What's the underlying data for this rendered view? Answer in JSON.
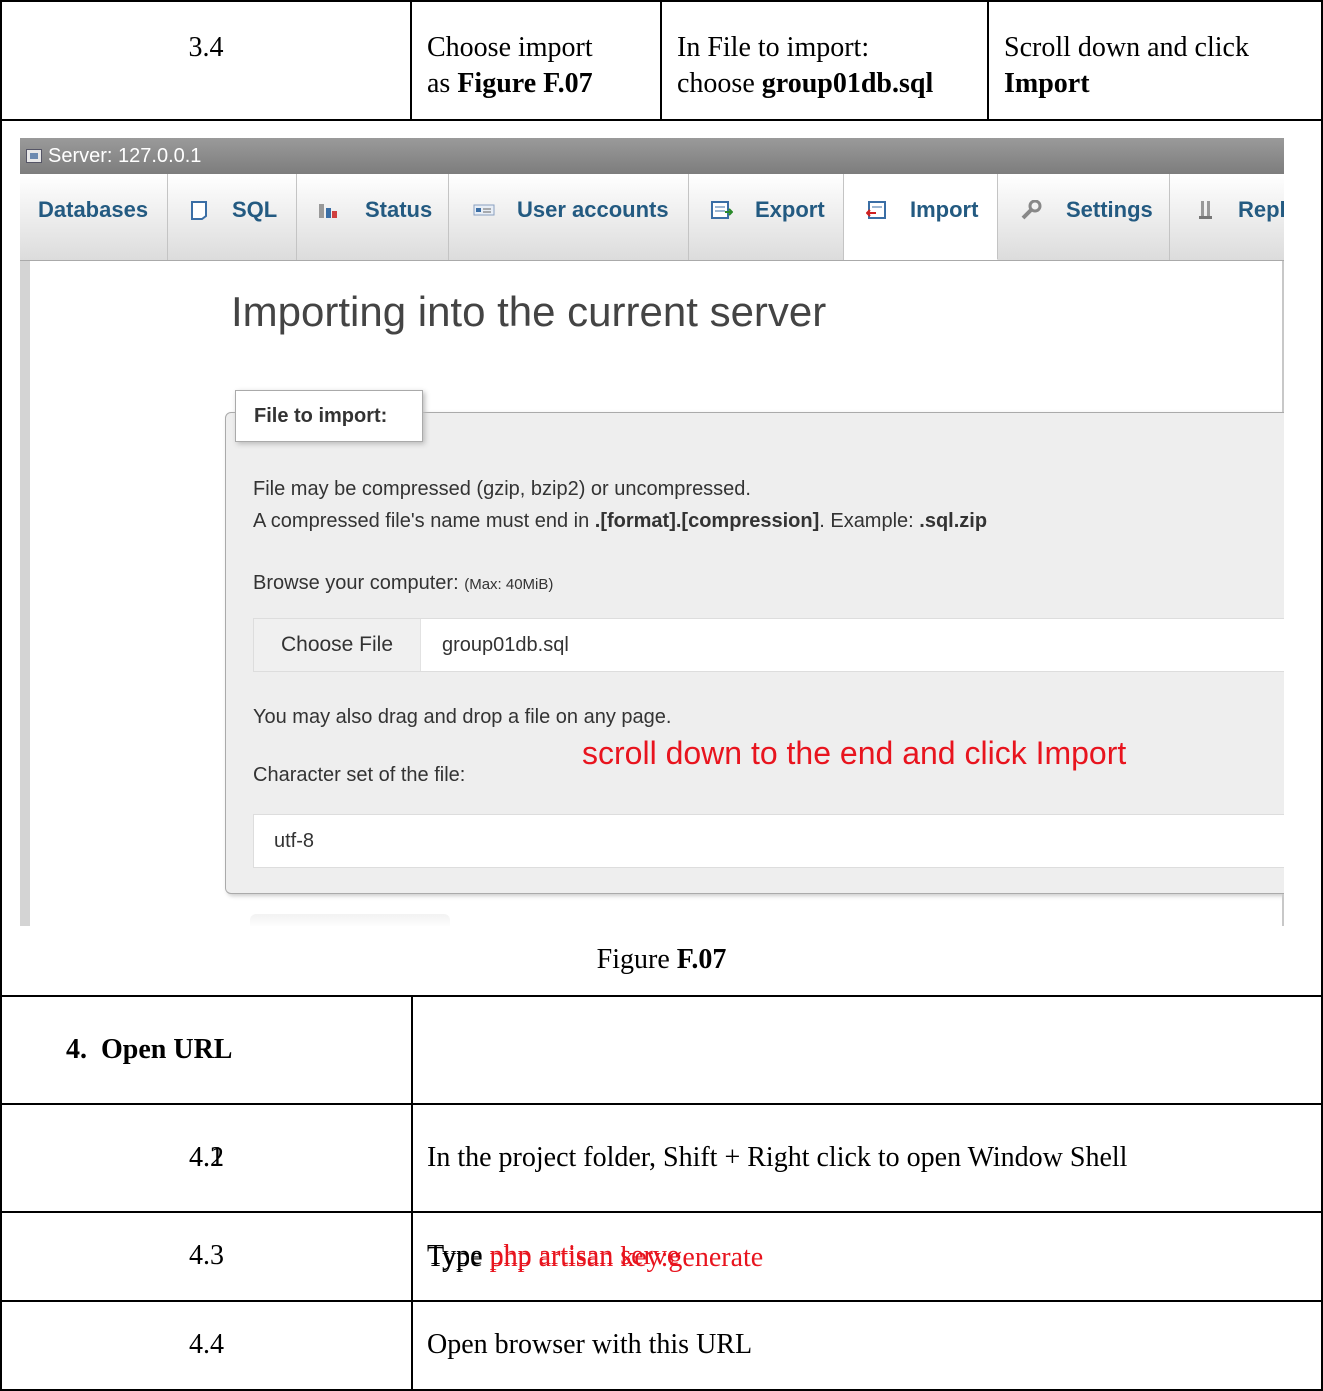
{
  "row_34": {
    "step": "3.4",
    "col2_line1": "Choose import",
    "col2_pre": "as ",
    "col2_bold": "Figure F.07",
    "col3_line1": "In File to import:",
    "col3_pre": "choose ",
    "col3_bold": "group01db.sql",
    "col4_line1": "Scroll down and click",
    "col4_bold": "Import"
  },
  "screenshot": {
    "server_label": "Server: 127.0.0.1",
    "tabs": [
      {
        "label": "Databases",
        "icon": "databases-icon"
      },
      {
        "label": "SQL",
        "icon": "sql-icon"
      },
      {
        "label": "Status",
        "icon": "status-icon"
      },
      {
        "label": "User accounts",
        "icon": "user-accounts-icon"
      },
      {
        "label": "Export",
        "icon": "export-icon"
      },
      {
        "label": "Import",
        "icon": "import-icon",
        "active": true
      },
      {
        "label": "Settings",
        "icon": "settings-icon"
      },
      {
        "label": "Repl",
        "icon": "replication-icon"
      }
    ],
    "heading": "Importing into the current server",
    "legend": "File to import:",
    "compress_line1": "File may be compressed (gzip, bzip2) or uncompressed.",
    "compress_line2_pre": "A compressed file's name must end in ",
    "compress_line2_bold": ".[format].[compression]",
    "compress_line2_mid": ". Example: ",
    "compress_line2_example": ".sql.zip",
    "browse_label": "Browse your computer: ",
    "browse_max": "(Max: 40MiB)",
    "choose_file_button": "Choose File",
    "chosen_file": "group01db.sql",
    "drag_drop_note": "You may also drag and drop a file on any page.",
    "annotation": "scroll down to the end and click Import",
    "charset_label": "Character set of the file:",
    "charset_value": "utf-8",
    "annotation_color": "#e8141e"
  },
  "caption": {
    "pre": "Figure ",
    "bold": "F.07"
  },
  "section4": {
    "title": "4.  Open URL",
    "rows": [
      {
        "step": "4.1",
        "text": "In the project folder, Shift + Right click to open Window Shell",
        "command": ""
      },
      {
        "step": "4.2",
        "text": "Type ",
        "command": "php artisan key:generate"
      },
      {
        "step": "4.3",
        "text": "Type ",
        "command": "php artisan serve"
      },
      {
        "step": "4.4",
        "text": "Open browser with this URL",
        "command": ""
      }
    ]
  }
}
